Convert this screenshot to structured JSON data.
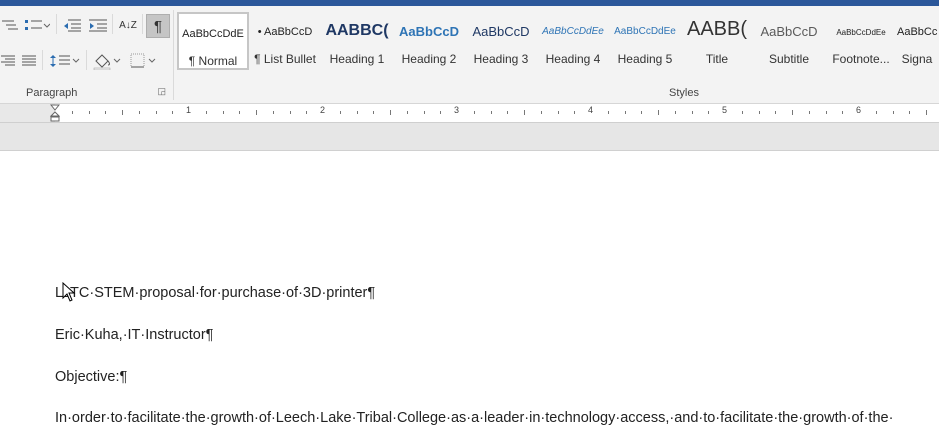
{
  "ribbon": {
    "paragraph_group_label": "Paragraph",
    "styles_group_label": "Styles",
    "pilcrow_glyph": "¶",
    "sort_glyph": "A↓Z",
    "styles": [
      {
        "preview": "AaBbCcDdE",
        "name": "¶ Normal"
      },
      {
        "preview": "• AaBbCcD",
        "name": "¶ List Bullet"
      },
      {
        "preview": "AABBC(",
        "name": "Heading 1"
      },
      {
        "preview": "AaBbCcD",
        "name": "Heading 2"
      },
      {
        "preview": "AaBbCcD",
        "name": "Heading 3"
      },
      {
        "preview": "AaBbCcDdEe",
        "name": "Heading 4"
      },
      {
        "preview": "AaBbCcDdEe",
        "name": "Heading 5"
      },
      {
        "preview": "AABB(",
        "name": "Title"
      },
      {
        "preview": "AaBbCcD",
        "name": "Subtitle"
      },
      {
        "preview": "AaBbCcDdEe",
        "name": "Footnote..."
      },
      {
        "preview": "AaBbCcDd",
        "name": "Signa"
      }
    ]
  },
  "ruler": {
    "numbers": [
      "1",
      "2",
      "3",
      "4",
      "5",
      "6"
    ]
  },
  "document": {
    "lines": [
      "LLTC·STEM·proposal·for·purchase·of·3D·printer¶",
      "Eric·Kuha,·IT·Instructor¶",
      "Objective:¶",
      "In·order·to·facilitate·the·growth·of·Leech·Lake·Tribal·College·as·a·leader·in·technology·access,·and·to·facilitate·the·growth·of·the·"
    ]
  },
  "colors": {
    "title_bar": "#2b579a",
    "ribbon_bg": "#f3f3f3",
    "heading_blue": "#2e74b5",
    "heading1_blue": "#1f3864"
  }
}
